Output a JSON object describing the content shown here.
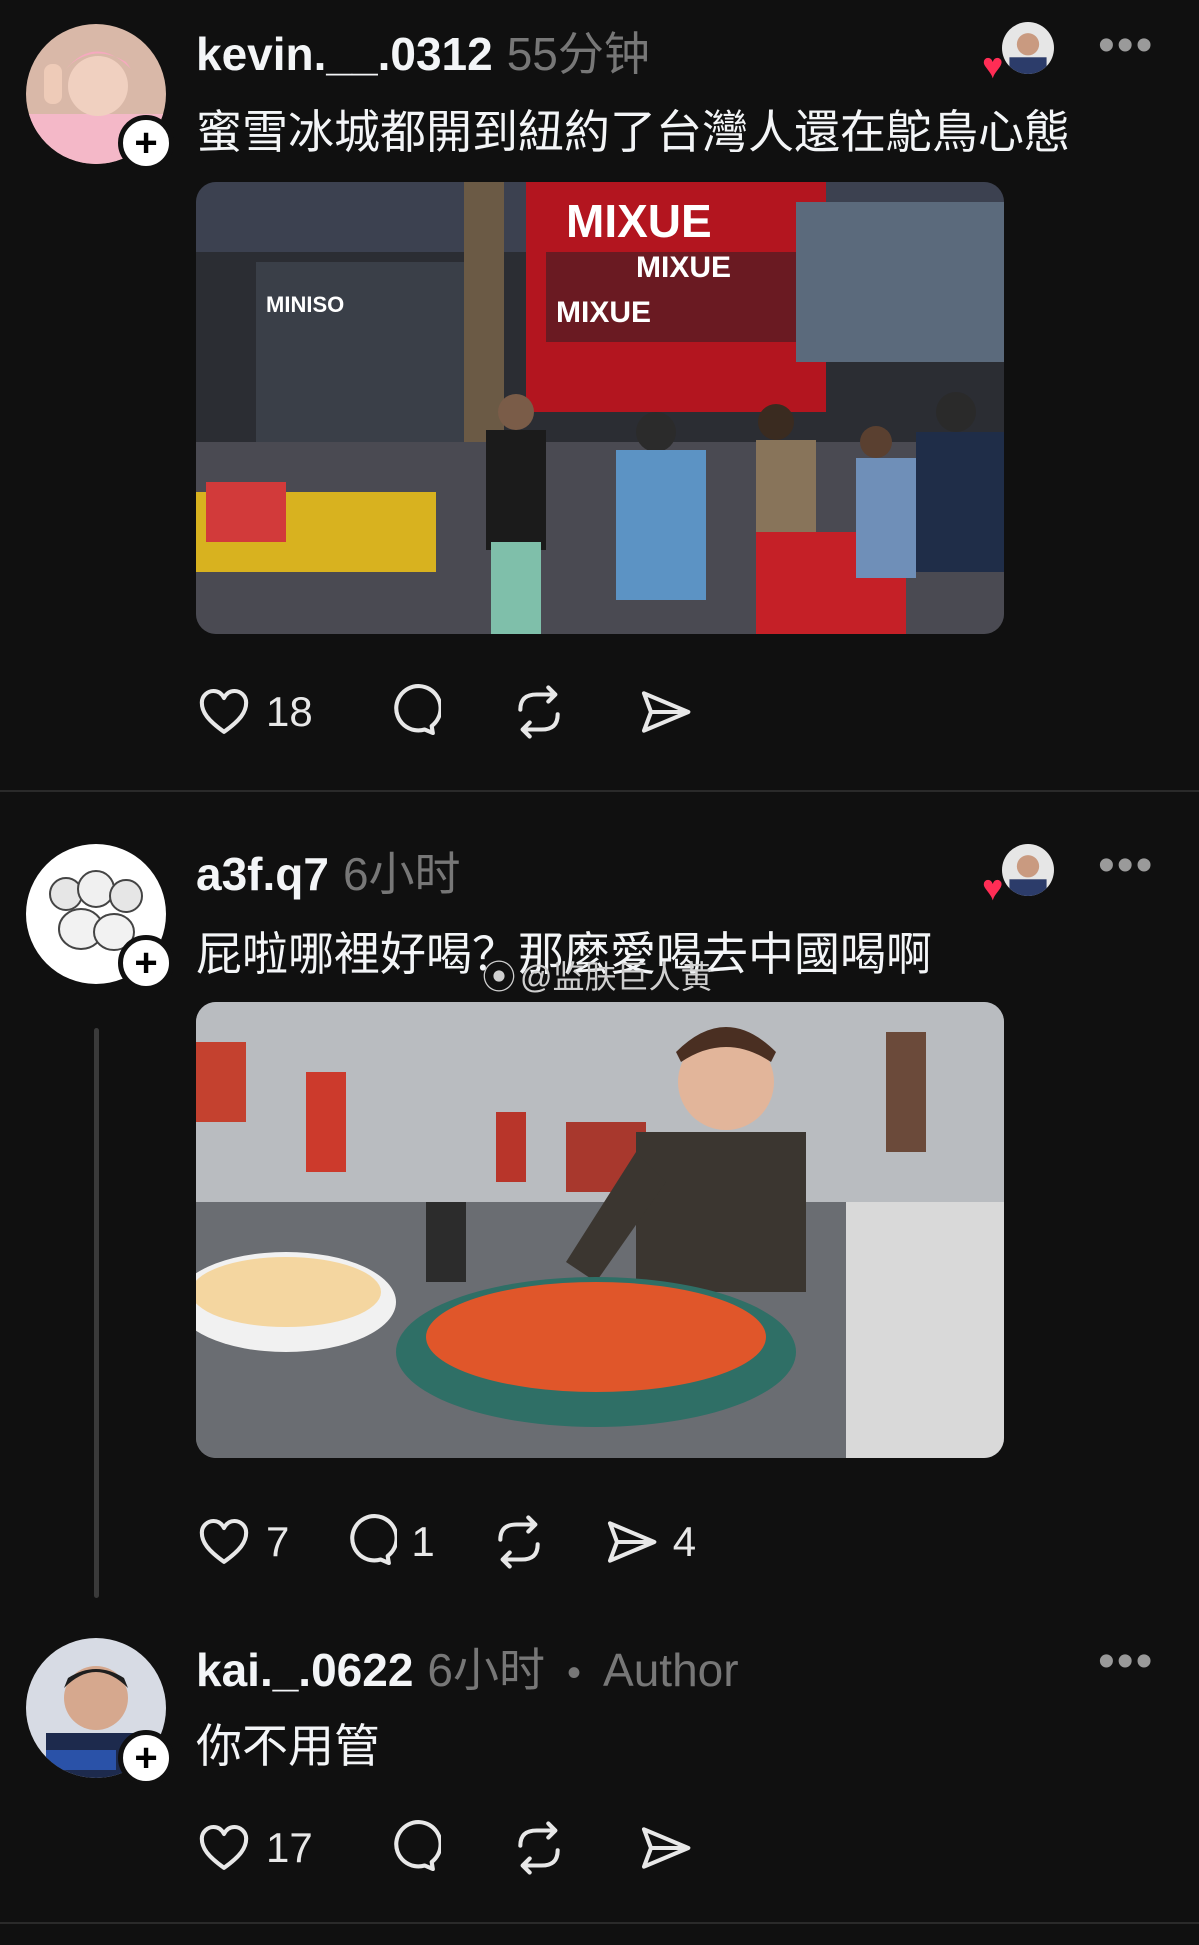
{
  "posts": [
    {
      "username": "kevin.__.0312",
      "time": "55分钟",
      "text": "蜜雪冰城都開到紐約了台灣人還在鴕鳥心態",
      "media_signs": [
        "MIXUE",
        "MIXUE",
        "MIXUE",
        "MINISO"
      ],
      "actions": {
        "likes": "18",
        "replies": "",
        "reposts": "",
        "shares": ""
      }
    },
    {
      "username": "a3f.q7",
      "time": "6小时",
      "text": "屁啦哪裡好喝？那麼愛喝去中國喝啊",
      "actions": {
        "likes": "7",
        "replies": "1",
        "reposts": "",
        "shares": "4"
      }
    },
    {
      "username": "kai._.0622",
      "time": "6小时",
      "author_label": "Author",
      "text": "你不用管",
      "actions": {
        "likes": "17",
        "replies": "",
        "reposts": "",
        "shares": ""
      }
    }
  ],
  "watermark": "@监肤巨人黄",
  "icons": [
    "heart-icon",
    "reply-icon",
    "repost-icon",
    "share-icon",
    "more-icon",
    "plus-icon"
  ],
  "colors": {
    "background": "#101010",
    "accent_heart": "#ff2d55",
    "muted": "#777777"
  }
}
